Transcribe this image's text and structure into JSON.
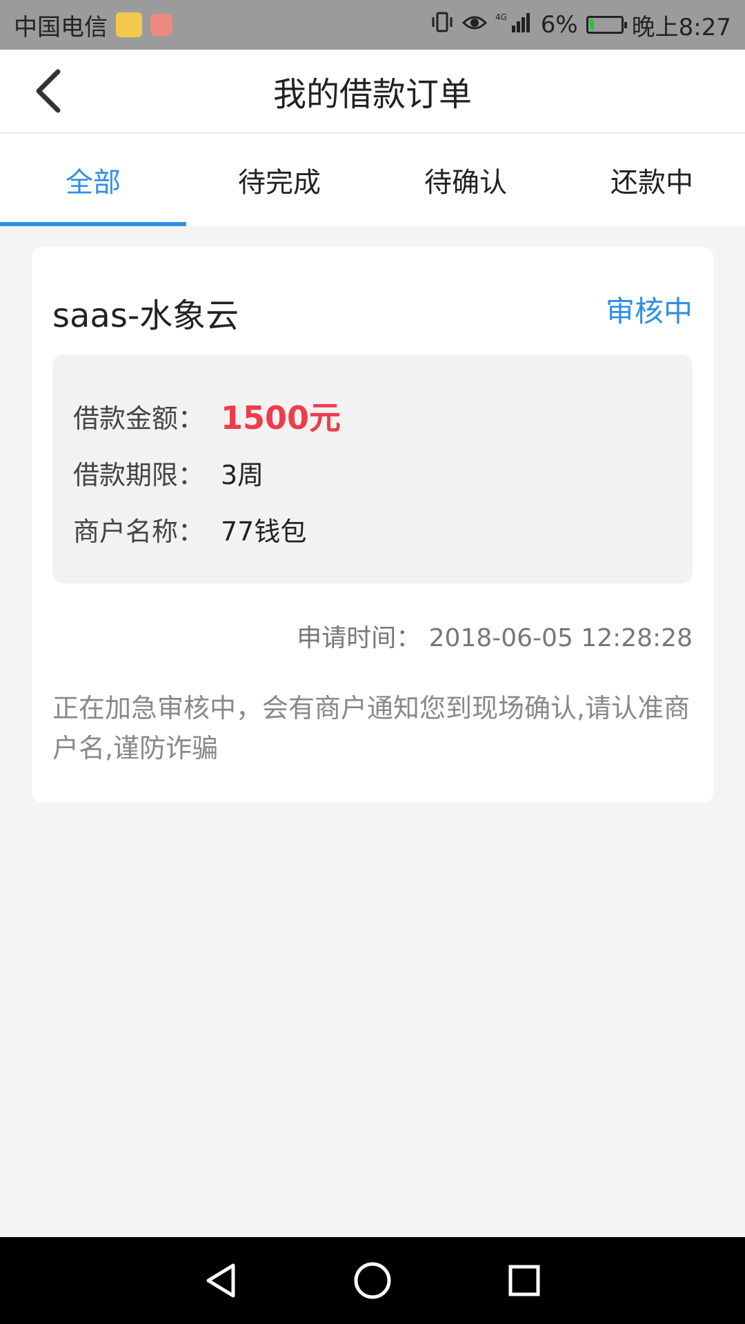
{
  "status_bar": {
    "carrier": "中国电信",
    "battery_percent": "6%",
    "time": "晚上8:27",
    "network": "4G"
  },
  "header": {
    "title": "我的借款订单"
  },
  "tabs": [
    {
      "label": "全部",
      "active": true
    },
    {
      "label": "待完成",
      "active": false
    },
    {
      "label": "待确认",
      "active": false
    },
    {
      "label": "还款中",
      "active": false
    }
  ],
  "order": {
    "name": "saas-水象云",
    "status": "审核中",
    "details": [
      {
        "label": "借款金额：",
        "value": "1500元"
      },
      {
        "label": "借款期限：",
        "value": "3周"
      },
      {
        "label": "商户名称：",
        "value": "77钱包"
      }
    ],
    "apply_time": "申请时间： 2018-06-05 12:28:28",
    "notice": "正在加急审核中，会有商户通知您到现场确认,请认准商户名,谨防诈骗"
  },
  "colors": {
    "accent": "#2f8fe6",
    "amount": "#ef3b4b",
    "background": "#f4f4f4"
  }
}
